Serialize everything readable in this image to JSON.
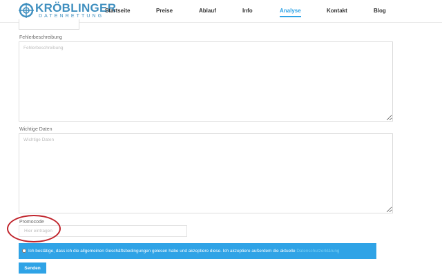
{
  "colors": {
    "brand": "#3f8fbf",
    "accent": "#2fa3e6",
    "annotation": "#c0242c",
    "link": "#7cd0f5"
  },
  "logo": {
    "name": "KRÖBLINGER",
    "sub": "DATENRETTUNG",
    "icon": "target-crosshair-icon"
  },
  "nav": {
    "items": [
      {
        "label": "Startseite",
        "active": false
      },
      {
        "label": "Preise",
        "active": false
      },
      {
        "label": "Ablauf",
        "active": false
      },
      {
        "label": "Info",
        "active": false
      },
      {
        "label": "Analyse",
        "active": true
      },
      {
        "label": "Kontakt",
        "active": false
      },
      {
        "label": "Blog",
        "active": false
      }
    ]
  },
  "form": {
    "fehler": {
      "label": "Fehlerbeschreibung",
      "placeholder": "Fehlerbeschreibung"
    },
    "daten": {
      "label": "Wichtige Daten",
      "placeholder": "Wichtige Daten"
    },
    "promo": {
      "label": "Promocode",
      "placeholder": "Hier eintragen"
    },
    "consent": {
      "text": "Ich bestätige, dass ich die allgemeinen Geschäftsbedingungen gelesen habe und akzeptiere diese. Ich akzeptiere außerdem die aktuelle",
      "link": "Datenschutzerklärung",
      "checked": false
    },
    "submit_label": "Senden"
  }
}
